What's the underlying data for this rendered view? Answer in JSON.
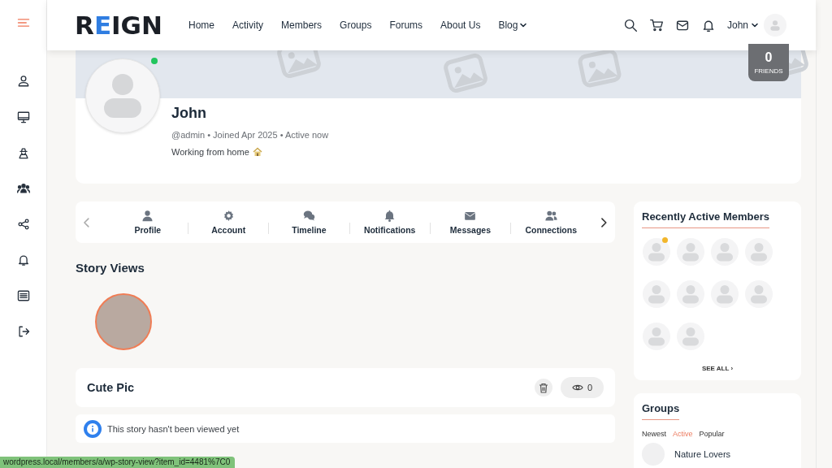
{
  "header": {
    "logo": "REIGN",
    "nav": [
      {
        "label": "Home",
        "dropdown": false
      },
      {
        "label": "Activity",
        "dropdown": false
      },
      {
        "label": "Members",
        "dropdown": false
      },
      {
        "label": "Groups",
        "dropdown": false
      },
      {
        "label": "Forums",
        "dropdown": false
      },
      {
        "label": "About Us",
        "dropdown": false
      },
      {
        "label": "Blog",
        "dropdown": true
      }
    ],
    "user": "John"
  },
  "profile": {
    "name": "John",
    "meta": "@admin • Joined Apr 2025 • Active now",
    "status": "Working from home",
    "online": true,
    "friends_count": "0",
    "friends_label": "FRIENDS"
  },
  "tabs": [
    {
      "label": "Profile"
    },
    {
      "label": "Account"
    },
    {
      "label": "Timeline"
    },
    {
      "label": "Notifications"
    },
    {
      "label": "Messages"
    },
    {
      "label": "Connections"
    }
  ],
  "story_views": {
    "title": "Story Views",
    "story_title": "Cute Pic",
    "views": "0",
    "notice": "This story hasn't been viewed yet"
  },
  "recently_active": {
    "title": "Recently Active Members",
    "members": [
      {
        "online": true
      },
      {
        "online": false
      },
      {
        "online": false
      },
      {
        "online": false
      },
      {
        "online": false
      },
      {
        "online": false
      },
      {
        "online": false
      },
      {
        "online": false
      },
      {
        "online": false
      },
      {
        "online": false
      }
    ],
    "see_all": "SEE ALL ›"
  },
  "groups": {
    "title": "Groups",
    "filters": [
      {
        "label": "Newest",
        "selected": false
      },
      {
        "label": "Active",
        "selected": true
      },
      {
        "label": "Popular",
        "selected": false
      }
    ],
    "items": [
      {
        "name": "Nature Lovers"
      }
    ]
  },
  "status_bar": "wordpress.local/members/a/wp-story-view?item_id=4481%7C0"
}
